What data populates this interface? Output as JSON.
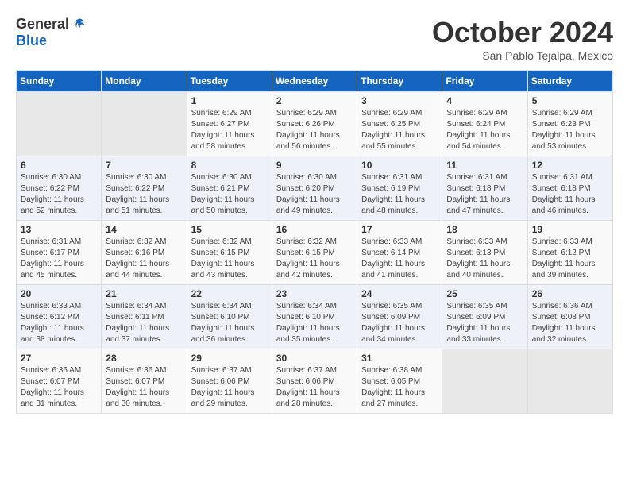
{
  "logo": {
    "general": "General",
    "blue": "Blue"
  },
  "header": {
    "month": "October 2024",
    "location": "San Pablo Tejalpa, Mexico"
  },
  "weekdays": [
    "Sunday",
    "Monday",
    "Tuesday",
    "Wednesday",
    "Thursday",
    "Friday",
    "Saturday"
  ],
  "weeks": [
    [
      {
        "day": "",
        "info": ""
      },
      {
        "day": "",
        "info": ""
      },
      {
        "day": "1",
        "info": "Sunrise: 6:29 AM\nSunset: 6:27 PM\nDaylight: 11 hours\nand 58 minutes."
      },
      {
        "day": "2",
        "info": "Sunrise: 6:29 AM\nSunset: 6:26 PM\nDaylight: 11 hours\nand 56 minutes."
      },
      {
        "day": "3",
        "info": "Sunrise: 6:29 AM\nSunset: 6:25 PM\nDaylight: 11 hours\nand 55 minutes."
      },
      {
        "day": "4",
        "info": "Sunrise: 6:29 AM\nSunset: 6:24 PM\nDaylight: 11 hours\nand 54 minutes."
      },
      {
        "day": "5",
        "info": "Sunrise: 6:29 AM\nSunset: 6:23 PM\nDaylight: 11 hours\nand 53 minutes."
      }
    ],
    [
      {
        "day": "6",
        "info": "Sunrise: 6:30 AM\nSunset: 6:22 PM\nDaylight: 11 hours\nand 52 minutes."
      },
      {
        "day": "7",
        "info": "Sunrise: 6:30 AM\nSunset: 6:22 PM\nDaylight: 11 hours\nand 51 minutes."
      },
      {
        "day": "8",
        "info": "Sunrise: 6:30 AM\nSunset: 6:21 PM\nDaylight: 11 hours\nand 50 minutes."
      },
      {
        "day": "9",
        "info": "Sunrise: 6:30 AM\nSunset: 6:20 PM\nDaylight: 11 hours\nand 49 minutes."
      },
      {
        "day": "10",
        "info": "Sunrise: 6:31 AM\nSunset: 6:19 PM\nDaylight: 11 hours\nand 48 minutes."
      },
      {
        "day": "11",
        "info": "Sunrise: 6:31 AM\nSunset: 6:18 PM\nDaylight: 11 hours\nand 47 minutes."
      },
      {
        "day": "12",
        "info": "Sunrise: 6:31 AM\nSunset: 6:18 PM\nDaylight: 11 hours\nand 46 minutes."
      }
    ],
    [
      {
        "day": "13",
        "info": "Sunrise: 6:31 AM\nSunset: 6:17 PM\nDaylight: 11 hours\nand 45 minutes."
      },
      {
        "day": "14",
        "info": "Sunrise: 6:32 AM\nSunset: 6:16 PM\nDaylight: 11 hours\nand 44 minutes."
      },
      {
        "day": "15",
        "info": "Sunrise: 6:32 AM\nSunset: 6:15 PM\nDaylight: 11 hours\nand 43 minutes."
      },
      {
        "day": "16",
        "info": "Sunrise: 6:32 AM\nSunset: 6:15 PM\nDaylight: 11 hours\nand 42 minutes."
      },
      {
        "day": "17",
        "info": "Sunrise: 6:33 AM\nSunset: 6:14 PM\nDaylight: 11 hours\nand 41 minutes."
      },
      {
        "day": "18",
        "info": "Sunrise: 6:33 AM\nSunset: 6:13 PM\nDaylight: 11 hours\nand 40 minutes."
      },
      {
        "day": "19",
        "info": "Sunrise: 6:33 AM\nSunset: 6:12 PM\nDaylight: 11 hours\nand 39 minutes."
      }
    ],
    [
      {
        "day": "20",
        "info": "Sunrise: 6:33 AM\nSunset: 6:12 PM\nDaylight: 11 hours\nand 38 minutes."
      },
      {
        "day": "21",
        "info": "Sunrise: 6:34 AM\nSunset: 6:11 PM\nDaylight: 11 hours\nand 37 minutes."
      },
      {
        "day": "22",
        "info": "Sunrise: 6:34 AM\nSunset: 6:10 PM\nDaylight: 11 hours\nand 36 minutes."
      },
      {
        "day": "23",
        "info": "Sunrise: 6:34 AM\nSunset: 6:10 PM\nDaylight: 11 hours\nand 35 minutes."
      },
      {
        "day": "24",
        "info": "Sunrise: 6:35 AM\nSunset: 6:09 PM\nDaylight: 11 hours\nand 34 minutes."
      },
      {
        "day": "25",
        "info": "Sunrise: 6:35 AM\nSunset: 6:09 PM\nDaylight: 11 hours\nand 33 minutes."
      },
      {
        "day": "26",
        "info": "Sunrise: 6:36 AM\nSunset: 6:08 PM\nDaylight: 11 hours\nand 32 minutes."
      }
    ],
    [
      {
        "day": "27",
        "info": "Sunrise: 6:36 AM\nSunset: 6:07 PM\nDaylight: 11 hours\nand 31 minutes."
      },
      {
        "day": "28",
        "info": "Sunrise: 6:36 AM\nSunset: 6:07 PM\nDaylight: 11 hours\nand 30 minutes."
      },
      {
        "day": "29",
        "info": "Sunrise: 6:37 AM\nSunset: 6:06 PM\nDaylight: 11 hours\nand 29 minutes."
      },
      {
        "day": "30",
        "info": "Sunrise: 6:37 AM\nSunset: 6:06 PM\nDaylight: 11 hours\nand 28 minutes."
      },
      {
        "day": "31",
        "info": "Sunrise: 6:38 AM\nSunset: 6:05 PM\nDaylight: 11 hours\nand 27 minutes."
      },
      {
        "day": "",
        "info": ""
      },
      {
        "day": "",
        "info": ""
      }
    ]
  ]
}
